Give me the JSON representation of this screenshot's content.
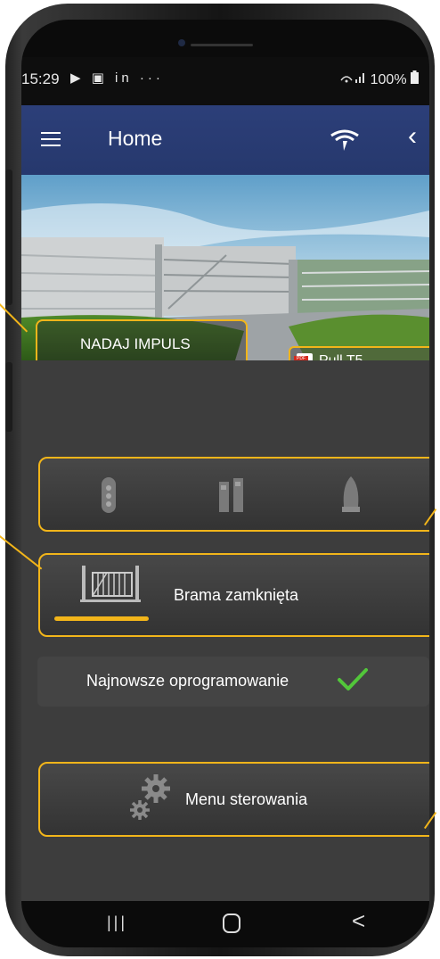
{
  "status_bar": {
    "time": "15:29",
    "left_icons": "▶ ▣ in ···",
    "right_text": "100%"
  },
  "app_bar": {
    "title": "Home",
    "menu_icon": "hamburger-icon",
    "connection_icon": "wifi-remote-icon",
    "back_icon": "back-chevron-icon"
  },
  "hero": {
    "impulse_button": "NADAJ IMPULS",
    "manual_button": "Pull T5",
    "manual_icon": "pdf-icon"
  },
  "devices": {
    "icons": [
      "remote-control-icon",
      "photocell-icon",
      "lamp-icon"
    ]
  },
  "gate": {
    "status": "Brama zamknięta",
    "icon": "sliding-gate-icon"
  },
  "firmware": {
    "label": "Najnowsze oprogramowanie",
    "icon": "checkmark-icon"
  },
  "control_menu": {
    "label": "Menu sterowania",
    "icon": "gears-icon"
  },
  "nav": {
    "recent": "|||",
    "back": "<"
  },
  "colors": {
    "accent": "#f2b51a",
    "app_bar": "#2a3c74",
    "background": "#3d3d3d",
    "check": "#52c63a"
  }
}
